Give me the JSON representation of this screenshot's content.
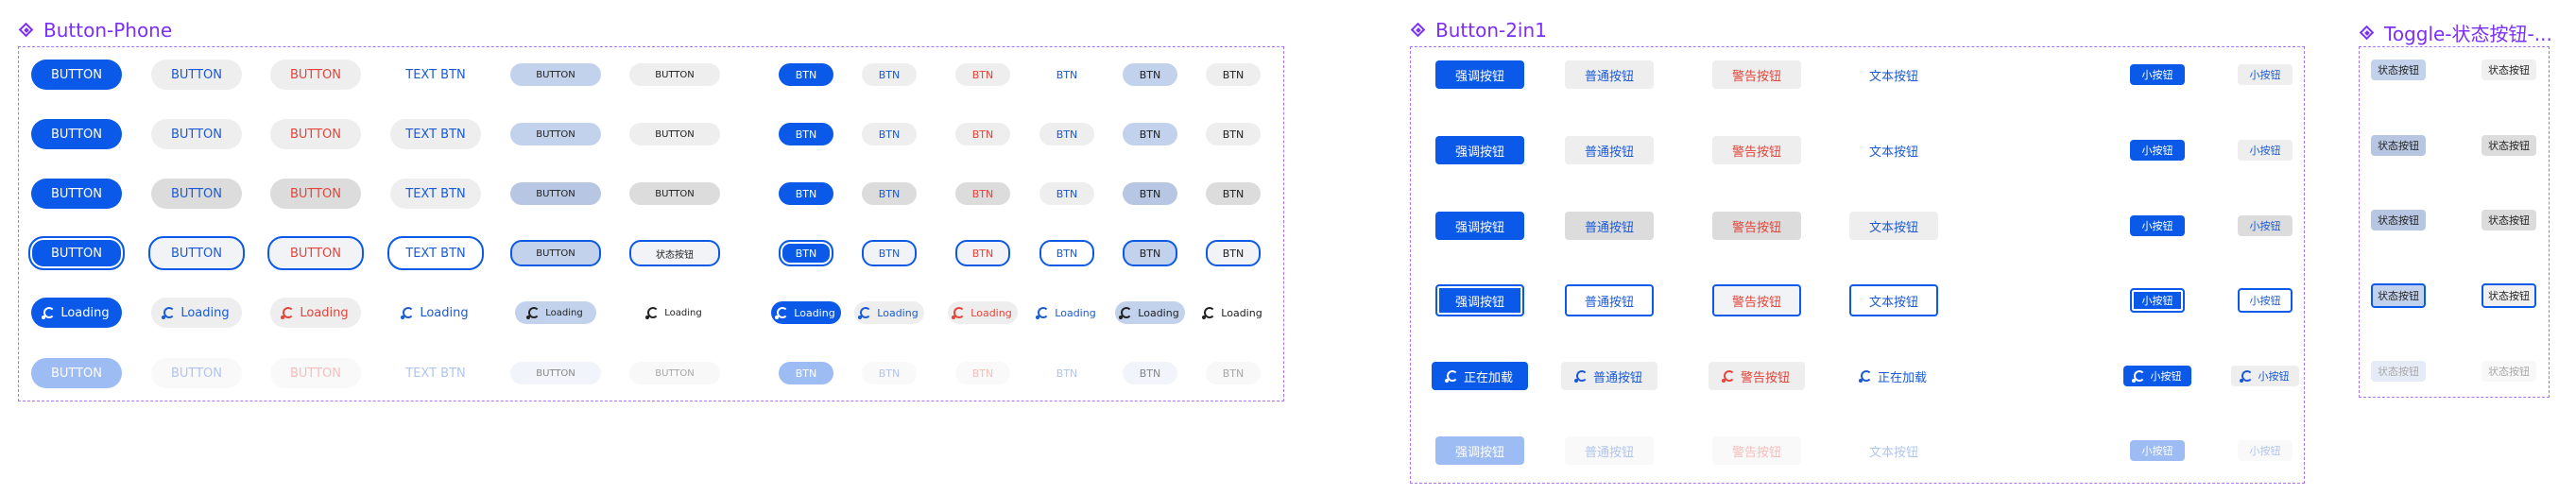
{
  "sections": {
    "phone_title": "Button-Phone",
    "twoin1_title": "Button-2in1",
    "toggle_title": "Toggle-状态按钮-..."
  },
  "colors": {
    "primary": "#0a59e8",
    "primary_disabled": "#9dbcf4",
    "normal_bg": "#eeeeef",
    "gray_bg": "#dcdcdd",
    "selected_bg": "#c2d2ec",
    "warning_text": "#e3453a",
    "blue_text": "#1a5ad6",
    "dark_text": "#222222",
    "frame": "#a974f5"
  },
  "phone": {
    "labels": [
      "BUTTON",
      "BUTTON",
      "BUTTON",
      "TEXT BTN",
      "BUTTON",
      "BUTTON",
      "BTN",
      "BTN",
      "BTN",
      "BTN",
      "BTN",
      "BTN"
    ],
    "focus_last_big": "状态按钮",
    "loading": "Loading"
  },
  "twoin1": {
    "labels": [
      "强调按钮",
      "普通按钮",
      "警告按钮",
      "文本按钮",
      "小按钮",
      "小按钮"
    ],
    "loading_labels": [
      "正在加载",
      "普通按钮",
      "警告按钮",
      "正在加载",
      "小按钮",
      "小按钮"
    ]
  },
  "toggle": {
    "label": "状态按钮"
  },
  "icons": {
    "section": "diamond-component-icon",
    "loading": "loading-spinner-icon"
  }
}
